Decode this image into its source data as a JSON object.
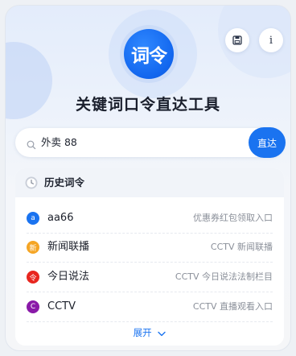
{
  "app": {
    "logo_text": "词令",
    "title": "关键词口令直达工具"
  },
  "header_actions": {
    "info_label": "i"
  },
  "search": {
    "value": "外卖 88",
    "button_label": "直达"
  },
  "history": {
    "title": "历史词令",
    "items": [
      {
        "icon_text": "a",
        "icon_color": "#1a73f0",
        "name": "aa66",
        "desc": "优惠券红包领取入口"
      },
      {
        "icon_text": "新",
        "icon_color": "#f5a524",
        "name": "新闻联播",
        "desc": "CCTV 新闻联播"
      },
      {
        "icon_text": "令",
        "icon_color": "#e8261f",
        "name": "今日说法",
        "desc": "CCTV 今日说法法制栏目"
      },
      {
        "icon_text": "C",
        "icon_color": "#8a1aa8",
        "name": "CCTV",
        "desc": "CCTV 直播观看入口"
      }
    ],
    "expand_label": "展开"
  }
}
